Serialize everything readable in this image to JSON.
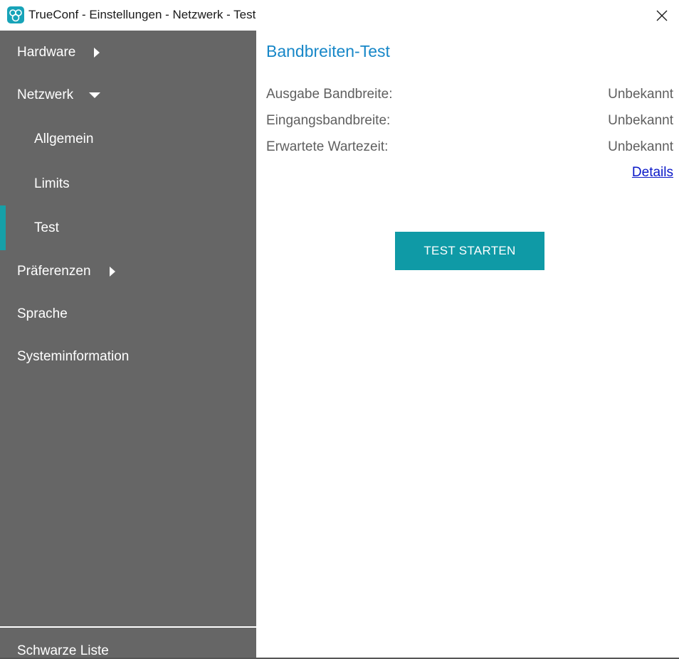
{
  "window": {
    "title": "TrueConf - Einstellungen - Netzwerk - Test",
    "close_icon": "close-icon",
    "app_icon": "trueconf-logo-icon"
  },
  "sidebar": {
    "items": [
      {
        "label": "Hardware",
        "level": "top",
        "arrow": "right"
      },
      {
        "label": "Netzwerk",
        "level": "top",
        "arrow": "down"
      },
      {
        "label": "Allgemein",
        "level": "sub"
      },
      {
        "label": "Limits",
        "level": "sub"
      },
      {
        "label": "Test",
        "level": "sub",
        "active": true
      },
      {
        "label": "Präferenzen",
        "level": "top",
        "arrow": "right"
      },
      {
        "label": "Sprache",
        "level": "top"
      },
      {
        "label": "Systeminformation",
        "level": "top"
      }
    ],
    "bottom_item": "Schwarze Liste"
  },
  "main": {
    "title": "Bandbreiten-Test",
    "rows": [
      {
        "label": "Ausgabe Bandbreite:",
        "value": "Unbekannt"
      },
      {
        "label": "Eingangsbandbreite:",
        "value": "Unbekannt"
      },
      {
        "label": "Erwartete Wartezeit:",
        "value": "Unbekannt"
      }
    ],
    "details_link": "Details",
    "start_button": "TEST STARTEN"
  },
  "colors": {
    "sidebar_bg": "#666666",
    "accent": "#0f9aa6",
    "title_blue": "#1787c8",
    "link": "#0a18c8"
  }
}
